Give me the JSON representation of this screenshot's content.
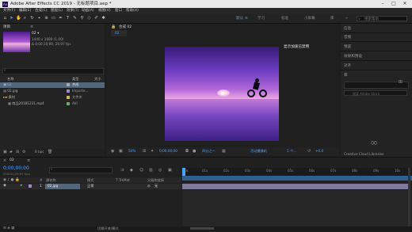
{
  "window": {
    "title": "Adobe After Effects CC 2019 - 无标题项目.aep *",
    "app_icon": "Ae"
  },
  "menu": [
    "文件(F)",
    "编辑(E)",
    "合成(C)",
    "图层(L)",
    "效果(T)",
    "动画(A)",
    "视图(V)",
    "窗口",
    "帮助(H)"
  ],
  "workspaces": [
    "默认",
    "学习",
    "标准",
    "小屏幕",
    "库"
  ],
  "active_workspace": "默认",
  "search_placeholder": "搜索帮助",
  "project": {
    "tab": "项目",
    "thumb_name": "02 ▾",
    "thumb_info": [
      "1440 x 1080 (1.00)",
      "Δ 0;00;10;00, 29.97 fps"
    ],
    "columns": {
      "name": "名称",
      "type": "类型",
      "size": "大小"
    },
    "items": [
      {
        "name": "02",
        "type": "合成",
        "size": ""
      },
      {
        "name": "02.jpg",
        "type": "Importe...",
        "size": ""
      },
      {
        "name": "素材",
        "type": "文件夹",
        "size": ""
      },
      {
        "name": "商品20181231.mp4",
        "type": "AVI",
        "size": ""
      }
    ],
    "bpc": "8 bpc"
  },
  "composition": {
    "tab": "合成 02",
    "sub_tab": "02",
    "tooltip": "显示加速已禁用",
    "footer": {
      "zoom": "50%",
      "time": "0;00;00;00",
      "quality": "四分之一",
      "camera": "活动摄像机",
      "views": "1 个..."
    }
  },
  "right_panel": {
    "items": [
      "信息",
      "音频",
      "预览",
      "效果和预设",
      "对齐",
      "库"
    ],
    "adobe_stock": "搜索 Adobe Stock",
    "cc_libraries": "Creative Cloud Libraries"
  },
  "timeline": {
    "tab": "02",
    "timecode": "0;00;00;00",
    "frame_info": "00000 (29.97 fps)",
    "search_placeholder": "",
    "columns": {
      "source": "源名称",
      "mode": "模式",
      "trkmat": "T TrkMat",
      "parent": "父级和链接"
    },
    "layer": {
      "num": "1",
      "name": "02.jpg",
      "mode": "正常",
      "parent": "无"
    },
    "ticks": [
      "0s",
      "01s",
      "02s",
      "03s",
      "04s",
      "05s",
      "06s",
      "07s",
      "08s",
      "09s",
      "10s"
    ],
    "footer": "切换开关/模式"
  }
}
